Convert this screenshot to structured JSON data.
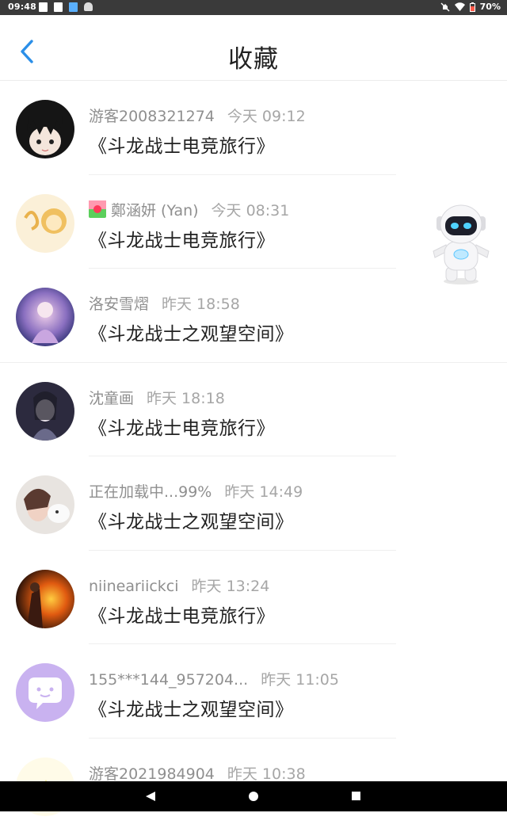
{
  "status": {
    "time": "09:48",
    "battery": "70%"
  },
  "header": {
    "title": "收藏"
  },
  "items": [
    {
      "name": "游客2008321274",
      "time": "今天 09:12",
      "game": "《斗龙战士电竞旅行》"
    },
    {
      "name": "鄭涵妍 (Yan)",
      "time": "今天 08:31",
      "game": "《斗龙战士电竞旅行》"
    },
    {
      "name": "洛安雪熠",
      "time": "昨天 18:58",
      "game": "《斗龙战士之观望空间》"
    },
    {
      "name": "沈童画",
      "time": "昨天 18:18",
      "game": "《斗龙战士电竞旅行》"
    },
    {
      "name": "正在加载中...99%",
      "time": "昨天 14:49",
      "game": "《斗龙战士之观望空间》"
    },
    {
      "name": "niineariickci",
      "time": "昨天 13:24",
      "game": "《斗龙战士电竞旅行》"
    },
    {
      "name": "155***144_957204...",
      "time": "昨天 11:05",
      "game": "《斗龙战士之观望空间》"
    },
    {
      "name": "游客2021984904",
      "time": "昨天 10:38",
      "game": ""
    }
  ],
  "colors": {
    "accent": "#2b8fe8",
    "status_bar": "#3a3a3a",
    "nav_bar": "#000000"
  }
}
